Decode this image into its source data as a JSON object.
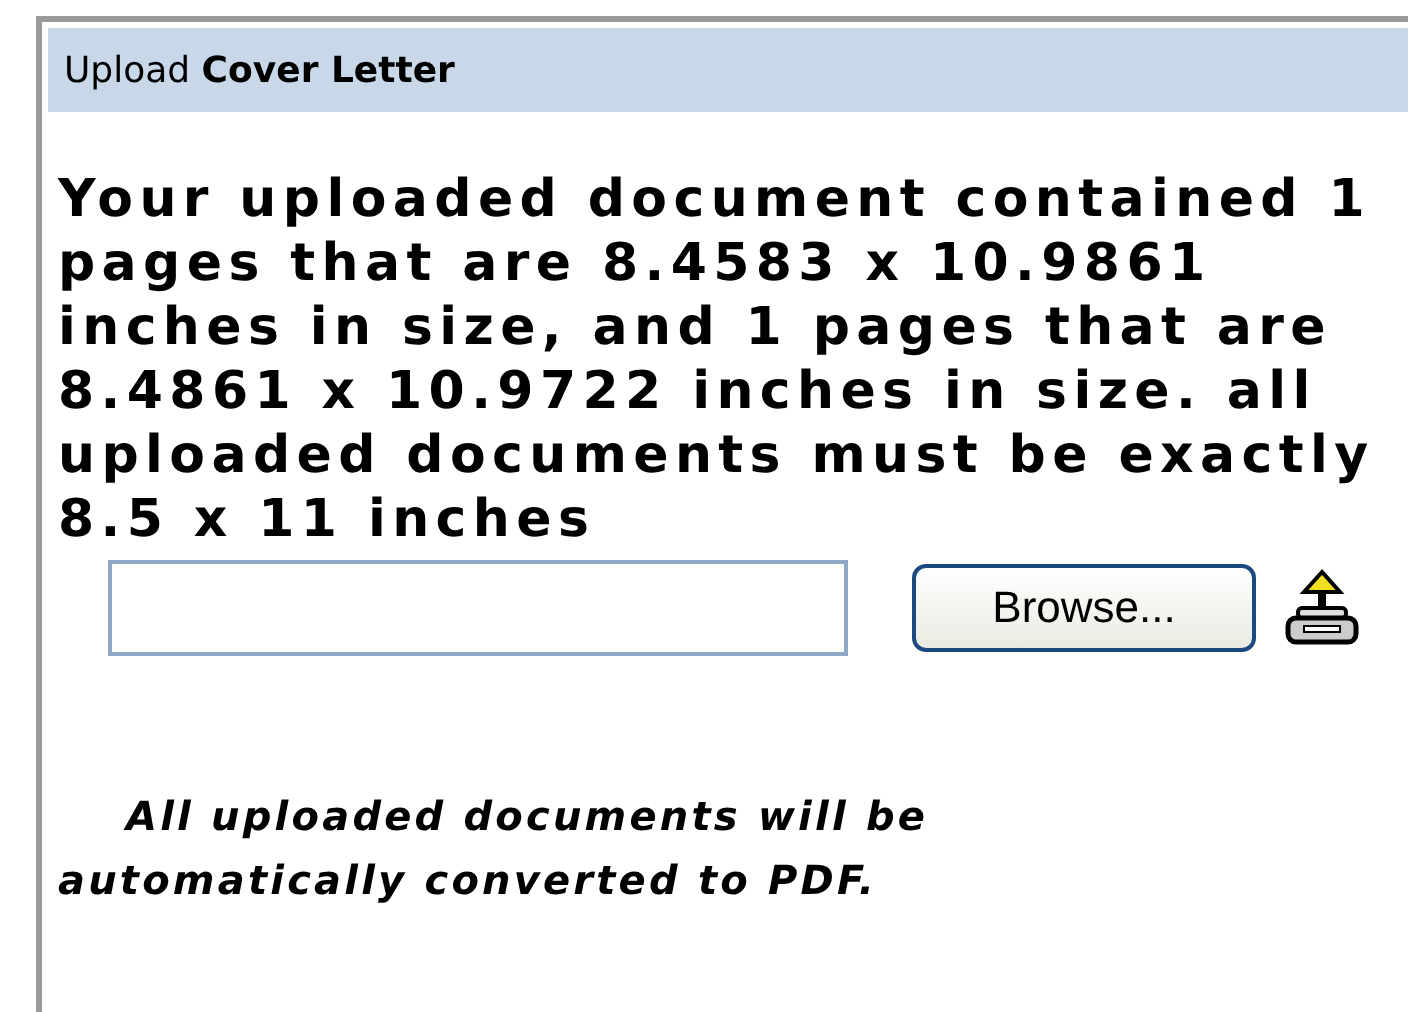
{
  "panel": {
    "title": "Upload **Cover Letter**"
  },
  "error_message": "Your uploaded document contained 1 pages that are 8.4583 x 10.9861 inches in size, and 1 pages that are 8.4861 x 10.9722 inches in size. all uploaded documents must be exactly 8.5 x 11 inches",
  "browse_button": {
    "label": "Browse..."
  },
  "note": "All uploaded documents will be automatically converted to PDF."
}
